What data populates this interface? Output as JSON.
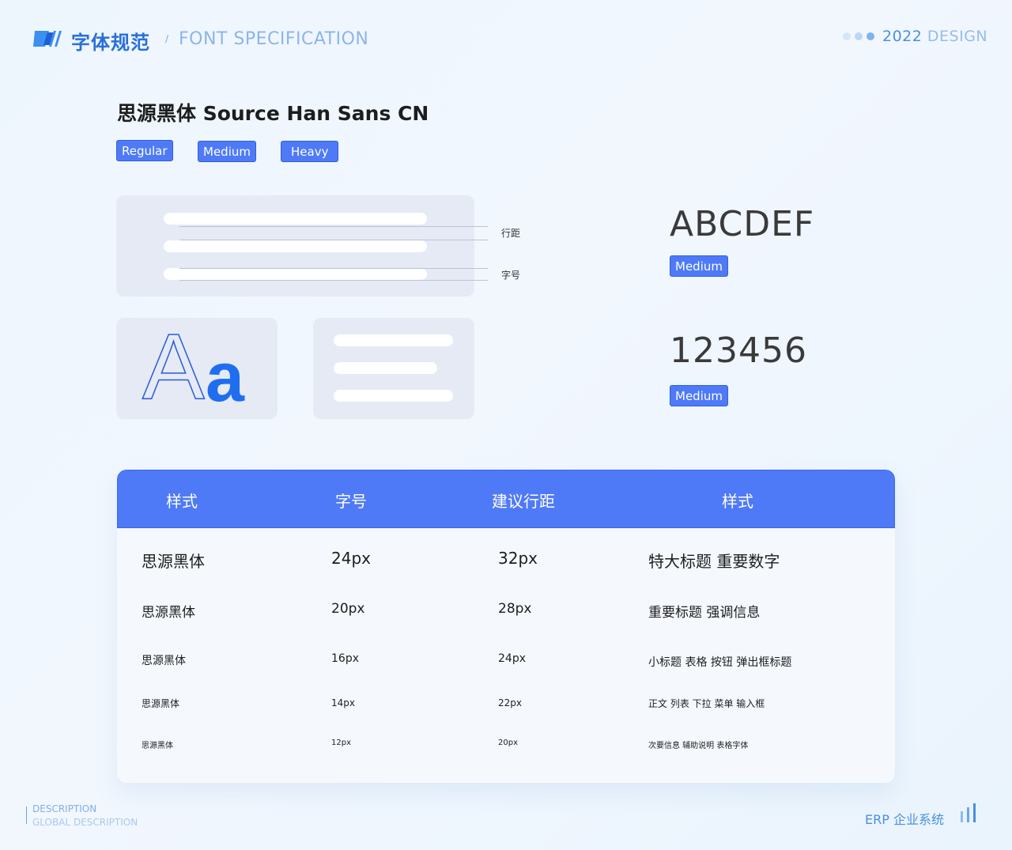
{
  "header": {
    "title_cn": "字体规范",
    "separator": "/",
    "title_en": "FONT SPECIFICATION",
    "year": "2022",
    "design": "DESIGN"
  },
  "font": {
    "name": "思源黑体  Source Han Sans CN",
    "weights": [
      "Regular",
      "Medium",
      "Heavy"
    ]
  },
  "illustration": {
    "line_spacing_label": "行距",
    "font_size_label": "字号",
    "aa_upper": "A",
    "aa_lower": "a"
  },
  "samples": [
    {
      "text": "ABCDEF",
      "weight": "Medium"
    },
    {
      "text": "123456",
      "weight": "Medium"
    }
  ],
  "table": {
    "headers": [
      "样式",
      "字号",
      "建议行距",
      "样式"
    ],
    "rows": [
      {
        "font": "思源黑体",
        "size": "24px",
        "line": "32px",
        "usage": "特大标题  重要数字"
      },
      {
        "font": "思源黑体",
        "size": "20px",
        "line": "28px",
        "usage": "重要标题  强调信息"
      },
      {
        "font": "思源黑体",
        "size": "16px",
        "line": "24px",
        "usage": "小标题  表格  按钮  弹出框标题"
      },
      {
        "font": "思源黑体",
        "size": "14px",
        "line": "22px",
        "usage": "正文  列表  下拉  菜单  输入框"
      },
      {
        "font": "思源黑体",
        "size": "12px",
        "line": "20px",
        "usage": "次要信息  辅助说明  表格字体"
      }
    ]
  },
  "footer": {
    "desc_line1": "DESCRIPTION",
    "desc_line2": "GLOBAL DESCRIPTION",
    "erp": "ERP 企业系统"
  },
  "colors": {
    "accent": "#4f7af7",
    "title_blue": "#2a6fd9",
    "card_bg": "#e5eaf5"
  },
  "icons": [
    "logo-slash-icon",
    "dots-icon",
    "bar-chart-icon"
  ]
}
